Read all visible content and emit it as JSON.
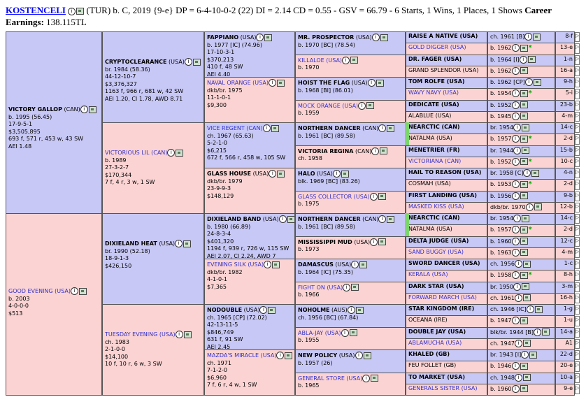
{
  "header": {
    "horse_name": "KOSTENCELI",
    "info": "(TUR) b. C, 2019 {9-e} DP = 6-4-10-0-2 (22) DI = 2.14   CD = 0.55 - GSV = 66.79 - 6 Starts, 1 Wins, 1 Places, 1 Shows",
    "career_label": "Career",
    "earnings_label": "Earnings:",
    "earnings_value": "138.115TL"
  },
  "gen1": [
    {
      "name": "VICTORY GALLOP",
      "country": " (CAN)",
      "lines": [
        "b. 1995 (56.45)",
        "17-9-5-1",
        "$3,505,895",
        "693 f, 571 r, 453 w, 43 SW",
        "AEI 1.48"
      ]
    },
    {
      "name": "GOOD EVENING",
      "country": " (USA)",
      "lines": [
        "b. 2003",
        "4-0-0-0",
        "$513"
      ]
    }
  ],
  "gen2": [
    {
      "name": "CRYPTOCLEARANCE",
      "country": " (USA)",
      "lines": [
        "br. 1984 (58.36)",
        "44-12-10-7",
        "$3,376,327",
        "1163 f, 966 r, 681 w, 42 SW",
        "AEI 1.20, CI 1.78, AWD 8.71"
      ]
    },
    {
      "name": "VICTORIOUS LIL",
      "country": " (CAN)",
      "lines": [
        "b. 1989",
        "27-3-2-7",
        "$170,344",
        "7 f, 4 r, 3 w, 1 SW"
      ]
    },
    {
      "name": "DIXIELAND HEAT",
      "country": " (USA)",
      "lines": [
        "br. 1990 (52.18)",
        "18-9-1-3",
        "$426,150"
      ]
    },
    {
      "name": "TUESDAY EVENING",
      "country": " (USA)",
      "lines": [
        "ch. 1983",
        "2-1-0-0",
        "$14,100",
        "10 f, 10 r, 6 w, 3 SW"
      ]
    }
  ],
  "gen3": [
    {
      "name": "FAPPIANO",
      "country": " (USA)",
      "lines": [
        "b. 1977 [IC] (74.96)",
        "17-10-3-1",
        "$370,213",
        "410 f, 48 SW",
        "AEI 4.40"
      ]
    },
    {
      "name": "NAVAL ORANGE",
      "country": " (USA)",
      "lines": [
        "dkb/br. 1975",
        "11-1-0-1",
        "$9,300"
      ]
    },
    {
      "name": "VICE REGENT",
      "country": " (CAN)",
      "lines": [
        "ch. 1967 (65.63)",
        "5-2-1-0",
        "$6,215",
        "672 f, 566 r, 458 w, 105 SW"
      ]
    },
    {
      "name": "GLASS HOUSE",
      "country": " (USA)",
      "lines": [
        "dkb/br. 1979",
        "23-9-9-3",
        "$148,129"
      ]
    },
    {
      "name": "DIXIELAND BAND",
      "country": " (USA)",
      "lines": [
        "b. 1980 (66.89)",
        "24-8-3-4",
        "$401,320",
        "1194 f, 939 r, 726 w, 115 SW",
        "AEI 2.07, CI 2.24, AWD 7"
      ]
    },
    {
      "name": "EVENING SILK",
      "country": " (USA)",
      "lines": [
        "dkb/br. 1982",
        "4-1-0-1",
        "$7,365"
      ]
    },
    {
      "name": "NODOUBLE",
      "country": " (USA)",
      "lines": [
        "ch. 1965 [CP] (72.02)",
        "42-13-11-5",
        "$846,749",
        "631 f, 91 SW",
        "AEI 2.45"
      ]
    },
    {
      "name": "MAZDA'S MIRACLE",
      "country": " (USA)",
      "lines": [
        "ch. 1971",
        "7-1-2-0",
        "$6,960",
        "7 f, 6 r, 4 w, 1 SW"
      ]
    }
  ],
  "gen4": [
    {
      "name": "MR. PROSPECTOR",
      "country": " (USA)",
      "lines": [
        "b. 1970 [BC] (78.54)"
      ]
    },
    {
      "name": "KILLALOE",
      "country": " (USA)",
      "lines": [
        "b. 1970"
      ]
    },
    {
      "name": "HOIST THE FLAG",
      "country": " (USA)",
      "lines": [
        "b. 1968 [BI] (86.01)"
      ]
    },
    {
      "name": "MOCK ORANGE",
      "country": " (USA)",
      "lines": [
        "b. 1959"
      ]
    },
    {
      "name": "NORTHERN DANCER",
      "country": " (CAN)",
      "lines": [
        "b. 1961 [BC] (89.58)"
      ]
    },
    {
      "name": "VICTORIA REGINA",
      "country": " (CAN)",
      "lines": [
        "ch. 1958"
      ]
    },
    {
      "name": "HALO",
      "country": " (USA)",
      "lines": [
        "blk. 1969 [BC] (83.26)"
      ]
    },
    {
      "name": "GLASS COLLECTOR",
      "country": " (USA)",
      "lines": [
        "b. 1975"
      ]
    },
    {
      "name": "NORTHERN DANCER",
      "country": " (CAN)",
      "lines": [
        "b. 1961 [BC] (89.58)"
      ]
    },
    {
      "name": "MISSISSIPPI MUD",
      "country": " (USA)",
      "lines": [
        "b. 1973"
      ]
    },
    {
      "name": "DAMASCUS",
      "country": " (USA)",
      "lines": [
        "b. 1964 [IC] (75.35)"
      ]
    },
    {
      "name": "FIGHT ON",
      "country": " (USA)",
      "lines": [
        "b. 1966"
      ]
    },
    {
      "name": "NOHOLME",
      "country": " (AUS)",
      "lines": [
        "ch. 1956 [BC] (67.84)"
      ]
    },
    {
      "name": "ABLA-JAY",
      "country": " (USA)",
      "lines": [
        "b. 1955"
      ]
    },
    {
      "name": "NEW POLICY",
      "country": " (USA)",
      "lines": [
        "b. 1957 (26)"
      ]
    },
    {
      "name": "GENERAL STORE",
      "country": " (USA)",
      "lines": [
        "b. 1965"
      ]
    }
  ],
  "gen5": [
    {
      "name": "RAISE A NATIVE (USA)",
      "info": "ch. 1961 [B]",
      "tag": "8-f"
    },
    {
      "name": "GOLD DIGGER (USA)",
      "info": "b. 1962",
      "tag": "13-e"
    },
    {
      "name": "DR. FAGER (USA)",
      "info": "b. 1964 [I]",
      "tag": "1-n"
    },
    {
      "name": "GRAND SPLENDOR (USA)",
      "info": "b. 1962",
      "tag": "16-a"
    },
    {
      "name": "TOM ROLFE (USA)",
      "info": "b. 1962 [CP]",
      "tag": "9-h"
    },
    {
      "name": "WAVY NAVY (USA)",
      "info": "b. 1954",
      "tag": "5-i"
    },
    {
      "name": "DEDICATE (USA)",
      "info": "b. 1952",
      "tag": "23-b"
    },
    {
      "name": "ALABLUE (USA)",
      "info": "b. 1945",
      "tag": "4-m"
    },
    {
      "name": "NEARCTIC (CAN)",
      "info": "br. 1954",
      "tag": "14-c"
    },
    {
      "name": "NATALMA (USA)",
      "info": "b. 1957",
      "tag": "2-d"
    },
    {
      "name": "MENETRIER (FR)",
      "info": "br. 1944",
      "tag": "15-b"
    },
    {
      "name": "VICTORIANA (CAN)",
      "info": "b. 1952",
      "tag": "10-c"
    },
    {
      "name": "HAIL TO REASON (USA)",
      "info": "br. 1958 [C]",
      "tag": "4-n"
    },
    {
      "name": "COSMAH (USA)",
      "info": "b. 1953",
      "tag": "2-d"
    },
    {
      "name": "FIRST LANDING (USA)",
      "info": "b. 1956",
      "tag": "9-b"
    },
    {
      "name": "MASKED KISS (USA)",
      "info": "dkb/br. 1970",
      "tag": "12-b"
    },
    {
      "name": "NEARCTIC (CAN)",
      "info": "br. 1954",
      "tag": "14-c"
    },
    {
      "name": "NATALMA (USA)",
      "info": "b. 1957",
      "tag": "2-d"
    },
    {
      "name": "DELTA JUDGE (USA)",
      "info": "b. 1960",
      "tag": "12-c"
    },
    {
      "name": "SAND BUGGY (USA)",
      "info": "b. 1963",
      "tag": "4-m"
    },
    {
      "name": "SWORD DANCER (USA)",
      "info": "ch. 1956",
      "tag": "1-c"
    },
    {
      "name": "KERALA (USA)",
      "info": "b. 1958",
      "tag": "8-h"
    },
    {
      "name": "DARK STAR (USA)",
      "info": "br. 1950",
      "tag": "3-m"
    },
    {
      "name": "FORWARD MARCH (USA)",
      "info": "ch. 1961",
      "tag": "16-h"
    },
    {
      "name": "STAR KINGDOM (IRE)",
      "info": "ch. 1946 [IC]",
      "tag": "1-g"
    },
    {
      "name": "OCEANA (IRE)",
      "info": "b. 1947",
      "tag": "1-u"
    },
    {
      "name": "DOUBLE JAY (USA)",
      "info": "blk/br. 1944 [B]",
      "tag": "14-a"
    },
    {
      "name": "ABLAMUCHA (USA)",
      "info": "ch. 1947",
      "tag": "A1"
    },
    {
      "name": "KHALED (GB)",
      "info": "br. 1943 [I]",
      "tag": "22-d"
    },
    {
      "name": "FEU FOLLET (GB)",
      "info": "b. 1946",
      "tag": "20-e"
    },
    {
      "name": "TO MARKET (USA)",
      "info": "ch. 1948",
      "tag": "10-a"
    },
    {
      "name": "GENERALS SISTER (USA)",
      "info": "b. 1960",
      "tag": "9-e"
    }
  ]
}
